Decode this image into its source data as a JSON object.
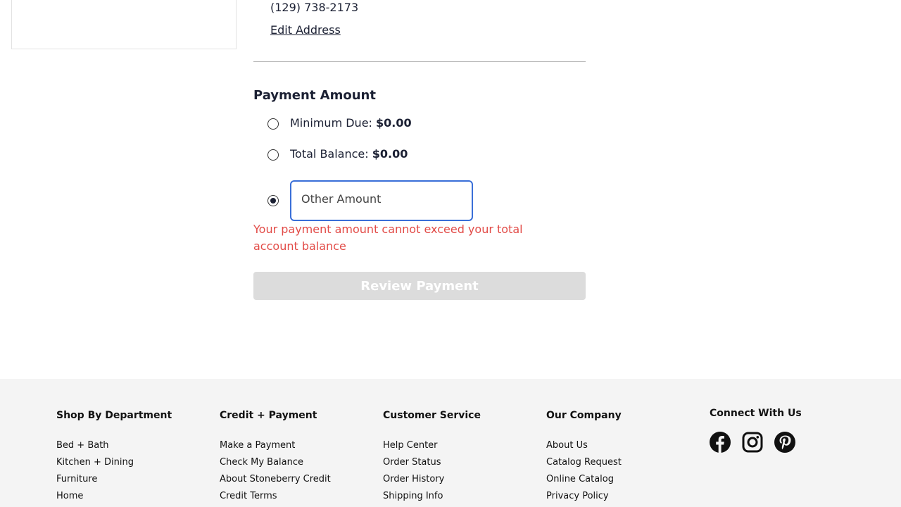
{
  "address": {
    "phone": "(129) 738-2173",
    "edit_label": "Edit Address"
  },
  "payment": {
    "title": "Payment Amount",
    "options": [
      {
        "label": "Minimum Due:",
        "value": "$0.00",
        "selected": false
      },
      {
        "label": "Total Balance:",
        "value": "$0.00",
        "selected": false
      },
      {
        "label": "Other Amount",
        "value": "",
        "selected": true
      }
    ],
    "error": "Your payment amount cannot exceed your total account balance",
    "review_label": "Review Payment"
  },
  "colors": {
    "accent": "#3a6fd8",
    "error": "#e24b47",
    "disabled_button": "#dcdcdc",
    "footer_bg": "#f4f4f4"
  },
  "footer": {
    "columns": [
      {
        "title": "Shop By Department",
        "links": [
          "Bed + Bath",
          "Kitchen + Dining",
          "Furniture",
          "Home"
        ]
      },
      {
        "title": "Credit + Payment",
        "links": [
          "Make a Payment",
          "Check My Balance",
          "About Stoneberry Credit",
          "Credit Terms"
        ]
      },
      {
        "title": "Customer Service",
        "links": [
          "Help Center",
          "Order Status",
          "Order History",
          "Shipping Info"
        ]
      },
      {
        "title": "Our Company",
        "links": [
          "About Us",
          "Catalog Request",
          "Online Catalog",
          "Privacy Policy"
        ]
      }
    ],
    "connect_title": "Connect With Us",
    "social_icons": [
      "facebook-icon",
      "instagram-icon",
      "pinterest-icon"
    ]
  }
}
